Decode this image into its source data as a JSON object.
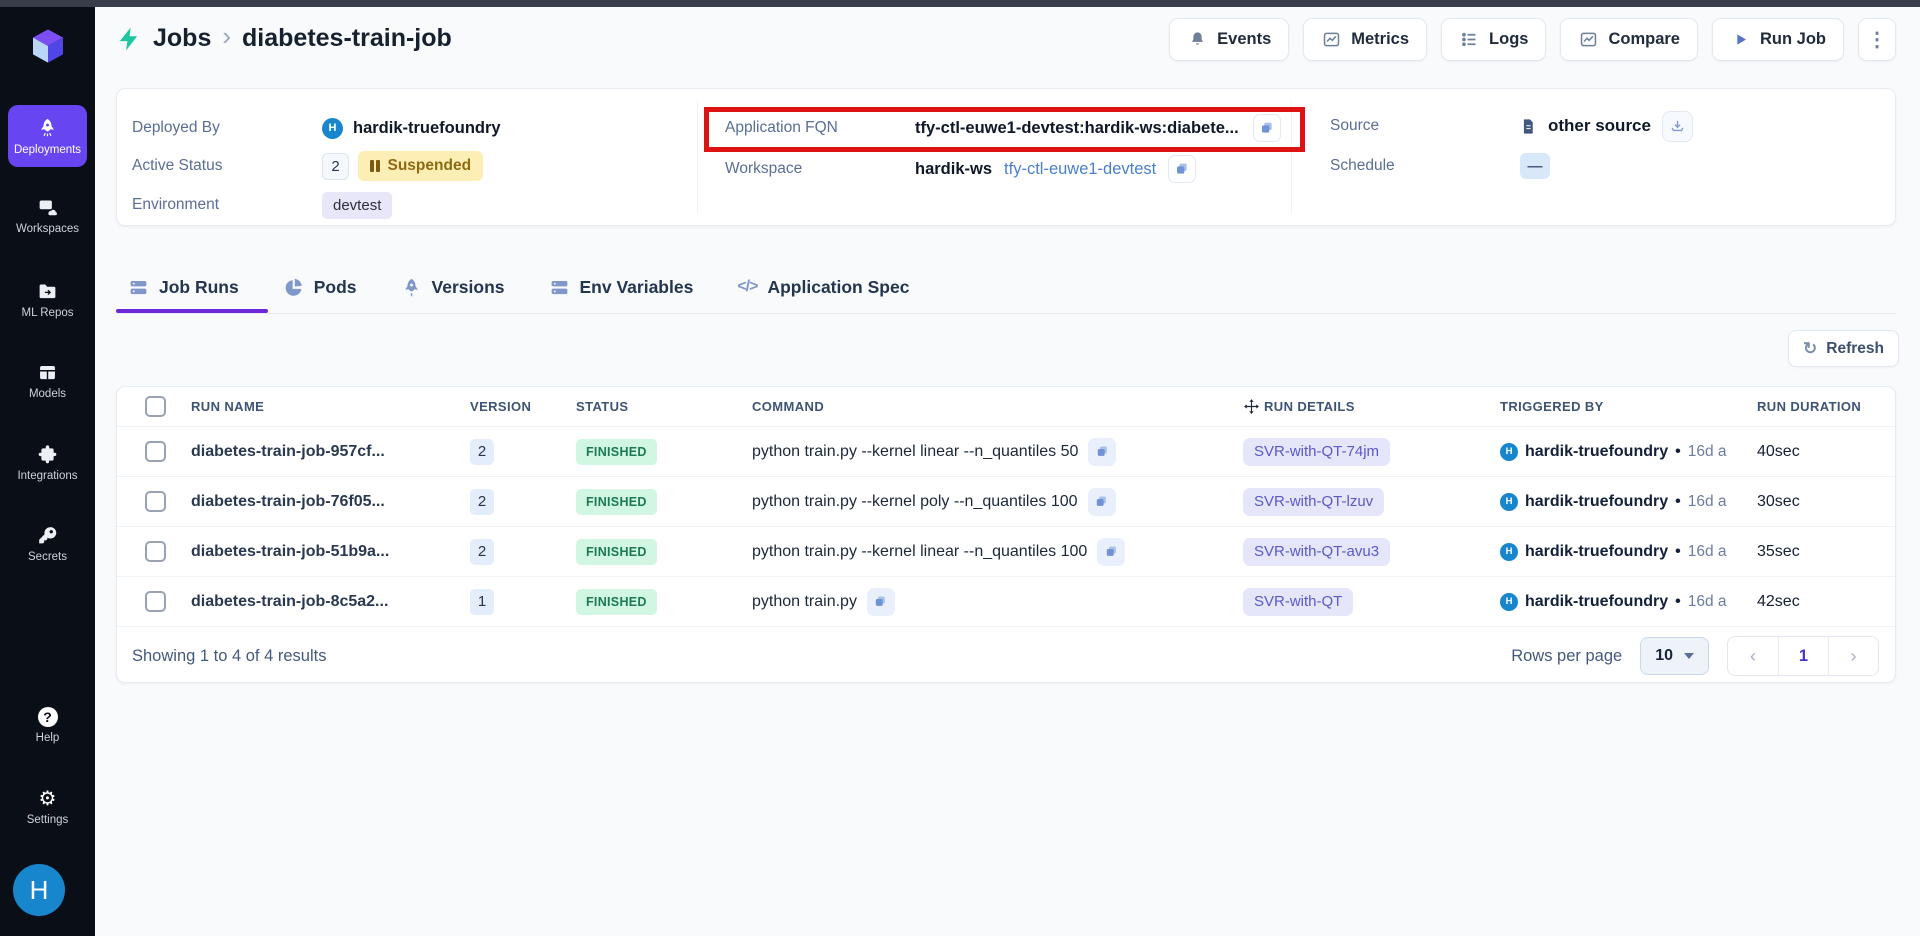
{
  "header": {
    "breadcrumb": {
      "section": "Jobs",
      "separator": "›",
      "title": "diabetes-train-job"
    },
    "actions": [
      {
        "label": "Events"
      },
      {
        "label": "Metrics"
      },
      {
        "label": "Logs"
      },
      {
        "label": "Compare"
      },
      {
        "label": "Run Job"
      }
    ]
  },
  "sidebar": {
    "items": [
      {
        "label": "Deployments",
        "active": true
      },
      {
        "label": "Workspaces"
      },
      {
        "label": "ML Repos"
      },
      {
        "label": "Models"
      },
      {
        "label": "Integrations"
      },
      {
        "label": "Secrets"
      }
    ],
    "footer_items": [
      {
        "label": "Help"
      },
      {
        "label": "Settings"
      }
    ],
    "avatar_letter": "H"
  },
  "info": {
    "deployed_by": {
      "label": "Deployed By",
      "value": "hardik-truefoundry",
      "avatar_letter": "H"
    },
    "active_status": {
      "label": "Active Status",
      "count": "2",
      "badge": "Suspended"
    },
    "environment": {
      "label": "Environment",
      "value": "devtest"
    },
    "application_fqn": {
      "label": "Application FQN",
      "value": "tfy-ctl-euwe1-devtest:hardik-ws:diabete..."
    },
    "workspace": {
      "label": "Workspace",
      "name": "hardik-ws",
      "link": "tfy-ctl-euwe1-devtest"
    },
    "source": {
      "label": "Source",
      "value": "other source"
    },
    "schedule": {
      "label": "Schedule",
      "value": "—"
    }
  },
  "tabs": [
    {
      "label": "Job Runs",
      "active": true
    },
    {
      "label": "Pods"
    },
    {
      "label": "Versions"
    },
    {
      "label": "Env Variables"
    },
    {
      "label": "Application Spec"
    }
  ],
  "table": {
    "refresh_label": "Refresh",
    "columns": {
      "run_name": "RUN NAME",
      "version": "VERSION",
      "status": "STATUS",
      "command": "COMMAND",
      "run_details": "RUN DETAILS",
      "triggered_by": "TRIGGERED BY",
      "run_duration": "RUN DURATION"
    },
    "avatar_letter": "H",
    "rows": [
      {
        "run_name": "diabetes-train-job-957cf...",
        "version": "2",
        "status": "FINISHED",
        "command": "python train.py --kernel linear --n_quantiles 50",
        "run_details": "SVR-with-QT-74jm",
        "triggered_by": "hardik-truefoundry",
        "triggered_when": "16d a",
        "duration": "40sec"
      },
      {
        "run_name": "diabetes-train-job-76f05...",
        "version": "2",
        "status": "FINISHED",
        "command": "python train.py --kernel poly --n_quantiles 100",
        "run_details": "SVR-with-QT-lzuv",
        "triggered_by": "hardik-truefoundry",
        "triggered_when": "16d a",
        "duration": "30sec"
      },
      {
        "run_name": "diabetes-train-job-51b9a...",
        "version": "2",
        "status": "FINISHED",
        "command": "python train.py --kernel linear --n_quantiles 100",
        "run_details": "SVR-with-QT-avu3",
        "triggered_by": "hardik-truefoundry",
        "triggered_when": "16d a",
        "duration": "35sec"
      },
      {
        "run_name": "diabetes-train-job-8c5a2...",
        "version": "1",
        "status": "FINISHED",
        "command": "python train.py",
        "run_details": "SVR-with-QT",
        "triggered_by": "hardik-truefoundry",
        "triggered_when": "16d a",
        "duration": "42sec"
      }
    ],
    "footer": {
      "showing": "Showing 1 to 4 of 4 results",
      "rows_per_page_label": "Rows per page",
      "rows_per_page_value": "10",
      "current_page": "1"
    }
  },
  "colors": {
    "sidebar_bg": "#0a0e16",
    "accent_purple": "#6746f2",
    "tab_underline": "#6d28d9",
    "annotation_red": "#dd1313",
    "finished_bg": "#d1f7e2",
    "finished_text": "#1b7a50",
    "suspended_bg": "#fceeb5",
    "suspended_text": "#8f6a11",
    "run_details_bg": "#e6e6fa",
    "run_details_text": "#5959c8",
    "avatar_blue": "#1886cd",
    "link_blue": "#4a7fc9",
    "bolt_green": "#1fc7a0"
  }
}
